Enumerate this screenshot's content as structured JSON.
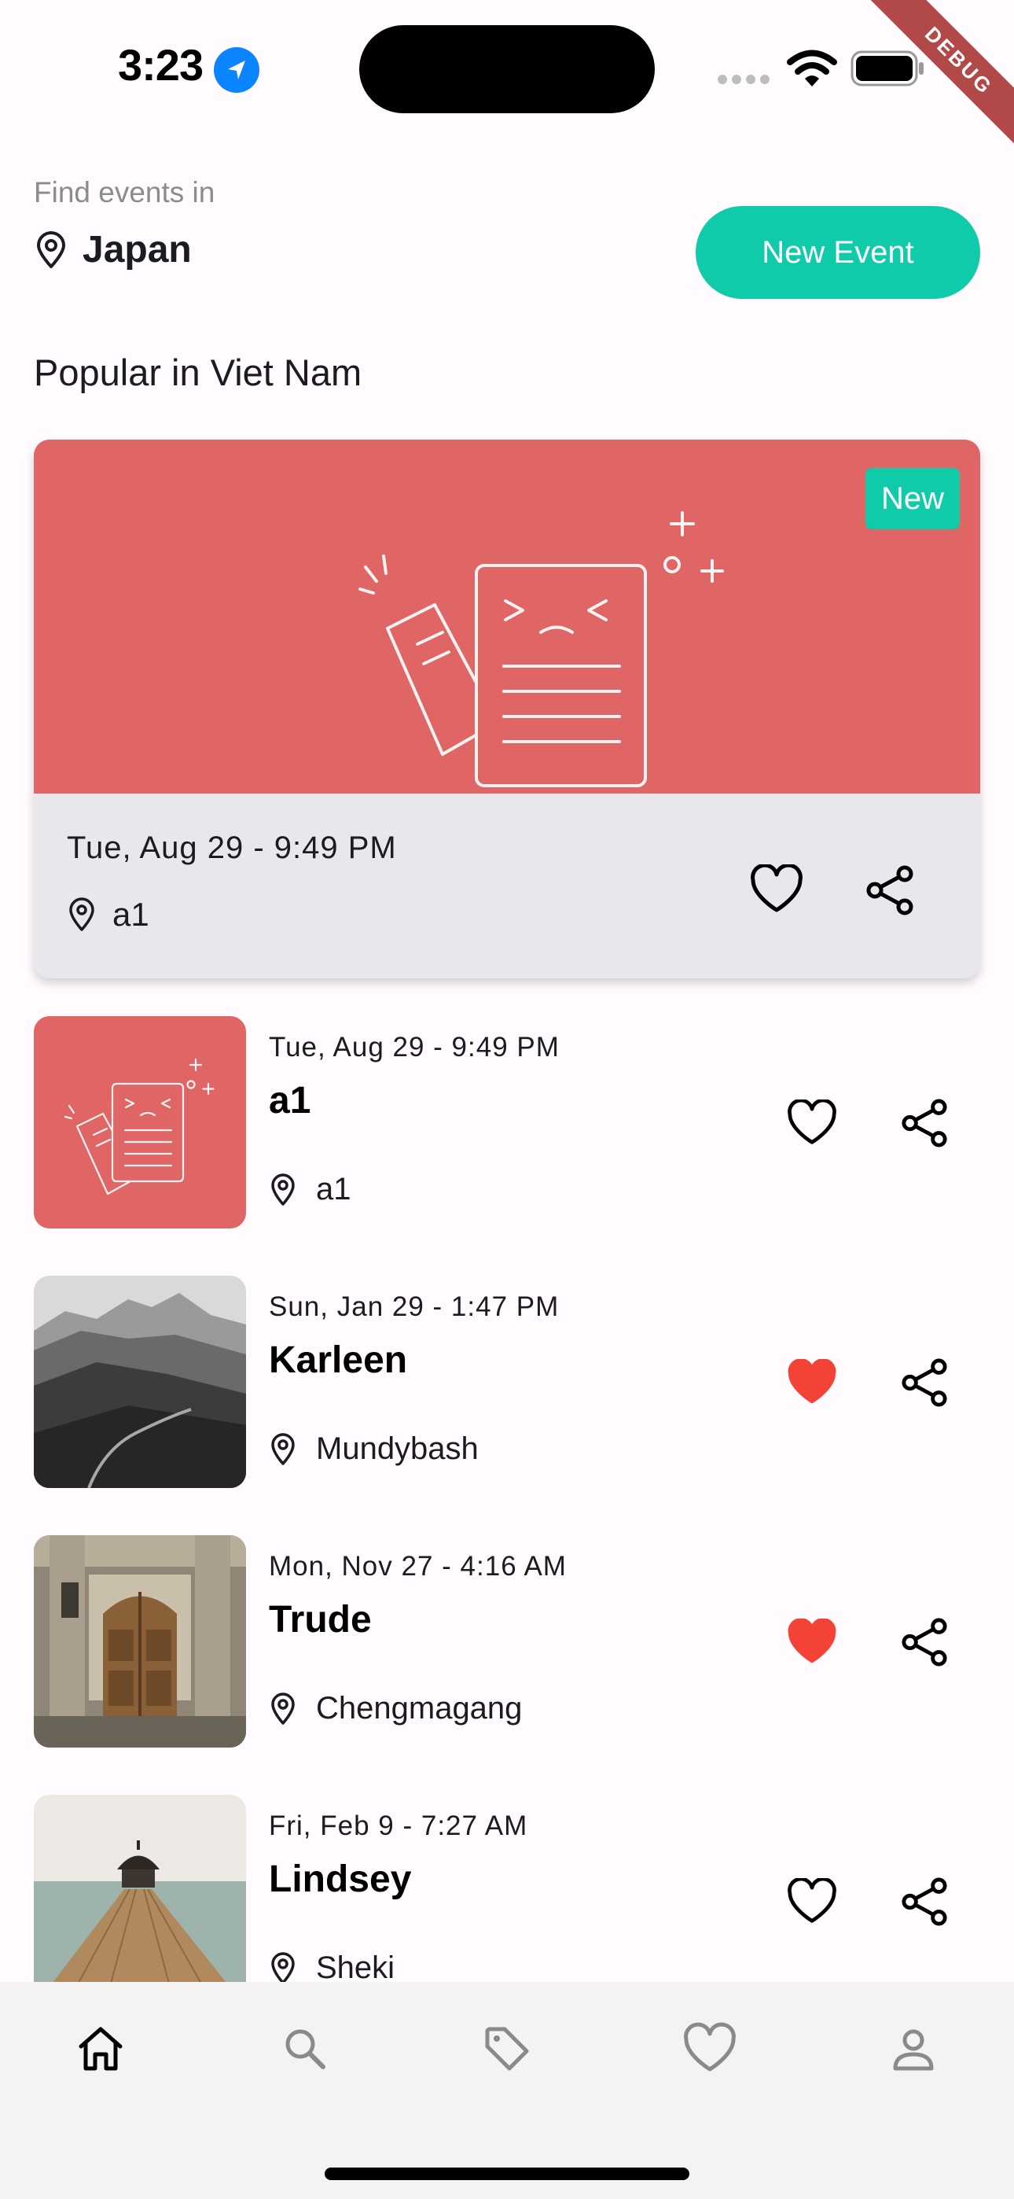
{
  "status_bar": {
    "time": "3:23",
    "debug_label": "DEBUG"
  },
  "header": {
    "find_label": "Find events in",
    "location": "Japan",
    "new_event_label": "New Event"
  },
  "section_title": "Popular in Viet Nam",
  "featured": {
    "badge": "New",
    "date": "Tue, Aug 29 - 9:49 PM",
    "place": "a1",
    "favorited": false,
    "image_bg": "#E06565"
  },
  "events": [
    {
      "date": "Tue, Aug 29 - 9:49 PM",
      "title": "a1",
      "place": "a1",
      "favorited": false,
      "thumb": "placeholder"
    },
    {
      "date": "Sun, Jan 29 - 1:47 PM",
      "title": "Karleen",
      "place": "Mundybash",
      "favorited": true,
      "thumb": "mountains"
    },
    {
      "date": "Mon, Nov 27 - 4:16 AM",
      "title": "Trude",
      "place": "Chengmagang",
      "favorited": true,
      "thumb": "door"
    },
    {
      "date": "Fri, Feb 9 - 7:27 AM",
      "title": "Lindsey",
      "place": "Sheki",
      "favorited": false,
      "thumb": "pier"
    }
  ],
  "nav": {
    "items": [
      "home-icon",
      "search-icon",
      "tag-icon",
      "heart-icon",
      "profile-icon"
    ],
    "active": 0
  },
  "colors": {
    "accent": "#0FCBAA",
    "favorite": "#F44336",
    "placeholder": "#E06565",
    "background": "#FFFBFE",
    "card": "#E8E8EC",
    "nav_bg": "#F3F3F3"
  }
}
